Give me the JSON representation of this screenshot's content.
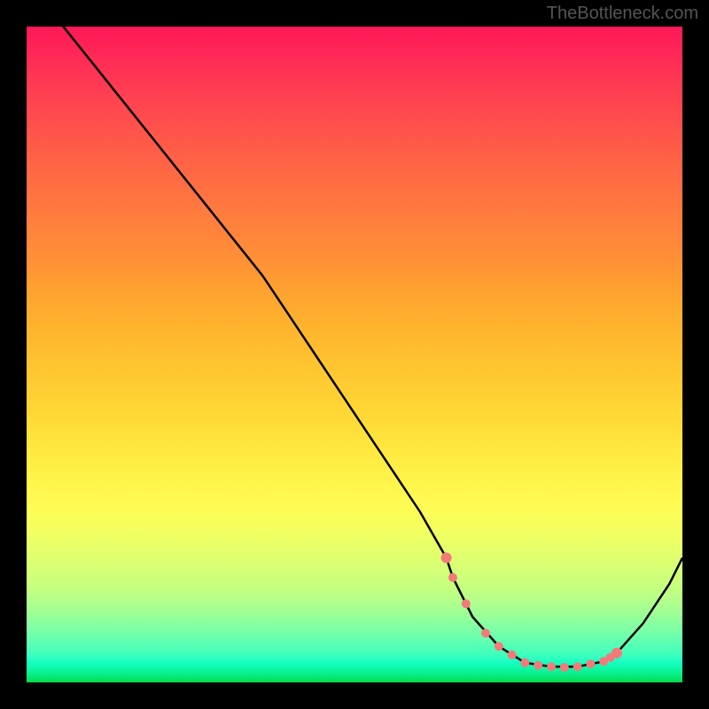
{
  "watermark": "TheBottleneck.com",
  "chart_data": {
    "type": "line",
    "title": "",
    "xlabel": "",
    "ylabel": "",
    "xlim": [
      0,
      100
    ],
    "ylim": [
      0,
      100
    ],
    "grid": false,
    "curve": {
      "x": [
        0,
        4,
        8,
        12,
        16,
        20,
        24,
        28,
        32,
        36,
        40,
        44,
        48,
        52,
        56,
        60,
        64,
        65,
        68,
        72,
        76,
        80,
        84,
        88,
        90,
        94,
        98,
        100
      ],
      "y": [
        108,
        102,
        97,
        92,
        87,
        82,
        77,
        72,
        67,
        62,
        56,
        50,
        44,
        38,
        32,
        26,
        19,
        16,
        10,
        5.5,
        3.0,
        2.4,
        2.4,
        3.2,
        4.5,
        9,
        15,
        19
      ]
    },
    "highlight_points": {
      "color": "#f47a7a",
      "x": [
        64,
        65,
        67,
        70,
        72,
        74,
        76,
        78,
        80,
        82,
        84,
        86,
        88,
        89,
        90
      ],
      "y": [
        19,
        16,
        12,
        7.5,
        5.5,
        4.2,
        3.0,
        2.6,
        2.4,
        2.3,
        2.4,
        2.8,
        3.2,
        3.8,
        4.5
      ]
    },
    "gradient_stops": [
      {
        "pct": 0,
        "color": "#ff1758"
      },
      {
        "pct": 50,
        "color": "#ffc530"
      },
      {
        "pct": 75,
        "color": "#fdfd56"
      },
      {
        "pct": 100,
        "color": "#04d948"
      }
    ]
  }
}
